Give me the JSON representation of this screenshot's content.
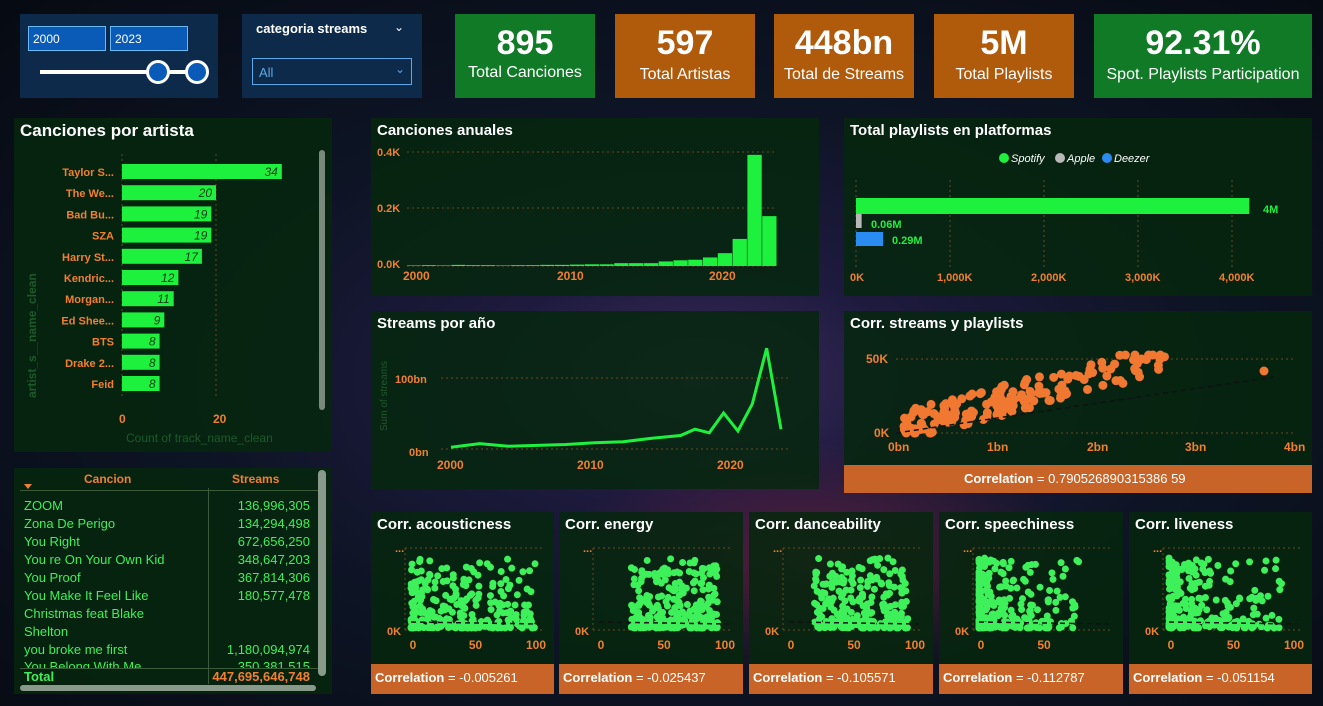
{
  "slicer": {
    "from": "2000",
    "to": "2023"
  },
  "category": {
    "title": "categoria streams",
    "value": "All"
  },
  "kpis": [
    {
      "value": "895",
      "label": "Total Canciones",
      "color": "#107a27"
    },
    {
      "value": "597",
      "label": "Total Artistas",
      "color": "#b05a0c"
    },
    {
      "value": "448bn",
      "label": "Total de Streams",
      "color": "#b05a0c"
    },
    {
      "value": "5M",
      "label": "Total Playlists",
      "color": "#b05a0c"
    },
    {
      "value": "92.31%",
      "label": "Spot. Playlists Participation",
      "color": "#107a27"
    }
  ],
  "artist_chart": {
    "title": "Canciones por artista",
    "ylabel": "artist_s__name_clean",
    "xlabel": "Count of track_name_clean",
    "xticks": [
      "0",
      "20"
    ]
  },
  "annual_chart": {
    "title": "Canciones anuales",
    "yticks": [
      "0.4K",
      "0.2K",
      "0.0K"
    ],
    "xticks": [
      "2000",
      "2010",
      "2020"
    ]
  },
  "streams_chart": {
    "title": "Streams por año",
    "ylabel": "Sum of streams",
    "yticks": [
      "100bn",
      "0bn"
    ],
    "xticks": [
      "2000",
      "2010",
      "2020"
    ]
  },
  "playlists_chart": {
    "title": "Total playlists en platformas",
    "legend": [
      "Spotify",
      "Apple",
      "Deezer"
    ],
    "xticks": [
      "0K",
      "1,000K",
      "2,000K",
      "3,000K",
      "4,000K"
    ],
    "labels": [
      "4M",
      "0.06M",
      "0.29M"
    ]
  },
  "scatter_main": {
    "title": "Corr. streams y playlists",
    "yticks": [
      "50K",
      "0K"
    ],
    "xticks": [
      "0bn",
      "1bn",
      "2bn",
      "3bn",
      "4bn"
    ],
    "corr_label": "Correlation",
    "corr_value": "= 0.790526890315386 59"
  },
  "small_corrs": [
    {
      "title": "Corr. acousticness",
      "corr": "= -0.005261",
      "xticks": [
        "0",
        "50",
        "100"
      ]
    },
    {
      "title": "Corr. energy",
      "corr": "= -0.025437",
      "xticks": [
        "0",
        "50",
        "100"
      ]
    },
    {
      "title": "Corr. danceability",
      "corr": "= -0.105571",
      "xticks": [
        "0",
        "50",
        "100"
      ]
    },
    {
      "title": "Corr. speechiness",
      "corr": "= -0.112787",
      "xticks": [
        "0",
        "50"
      ]
    },
    {
      "title": "Corr. liveness",
      "corr": "= -0.051154",
      "xticks": [
        "0",
        "50",
        "100"
      ]
    }
  ],
  "small_ytick": "0K",
  "small_ydots": "...",
  "corr_word": "Correlation",
  "table": {
    "headers": [
      "Cancion",
      "Streams"
    ],
    "rows": [
      {
        "c": "ZOOM",
        "s": "136,996,305"
      },
      {
        "c": "Zona De Perigo",
        "s": "134,294,498"
      },
      {
        "c": "You Right",
        "s": "672,656,250"
      },
      {
        "c": "You re On Your Own Kid",
        "s": "348,647,203"
      },
      {
        "c": "You Proof",
        "s": "367,814,306"
      },
      {
        "c": "You Make It Feel Like",
        "s": "180,577,478"
      },
      {
        "c": "Christmas feat Blake",
        "s": ""
      },
      {
        "c": "Shelton",
        "s": ""
      },
      {
        "c": "you broke me first",
        "s": "1,180,094,974"
      },
      {
        "c": "You Belong With Me",
        "s": "350,381,515"
      }
    ],
    "total_label": "Total",
    "total_value": "447,695,646,748"
  },
  "chart_data": [
    {
      "type": "bar",
      "title": "Canciones por artista",
      "xlabel": "Count of track_name_clean",
      "ylabel": "artist_s__name_clean",
      "categories": [
        "Taylor S...",
        "The We...",
        "Bad Bu...",
        "SZA",
        "Harry St...",
        "Kendric...",
        "Morgan...",
        "Ed Shee...",
        "BTS",
        "Drake 2...",
        "Feid"
      ],
      "values": [
        34,
        20,
        19,
        19,
        17,
        12,
        11,
        9,
        8,
        8,
        8
      ],
      "xlim": [
        0,
        40
      ],
      "color": "#1ef03e"
    },
    {
      "type": "bar",
      "title": "Canciones anuales",
      "x": [
        1999,
        2000,
        2001,
        2002,
        2003,
        2004,
        2005,
        2006,
        2007,
        2008,
        2009,
        2010,
        2011,
        2012,
        2013,
        2014,
        2015,
        2016,
        2017,
        2018,
        2019,
        2020,
        2021,
        2022,
        2023
      ],
      "values": [
        2,
        3,
        2,
        4,
        3,
        3,
        2,
        3,
        3,
        4,
        4,
        5,
        6,
        6,
        10,
        10,
        10,
        16,
        20,
        22,
        30,
        45,
        95,
        390,
        175
      ],
      "ylim": [
        0,
        400
      ],
      "color": "#1ef03e"
    },
    {
      "type": "line",
      "title": "Streams por año",
      "x": [
        2000,
        2002,
        2004,
        2006,
        2008,
        2010,
        2012,
        2014,
        2016,
        2017,
        2018,
        2019,
        2020,
        2021,
        2022,
        2023
      ],
      "values": [
        2,
        6,
        3,
        4,
        5,
        7,
        8,
        12,
        15,
        22,
        18,
        40,
        20,
        50,
        112,
        22
      ],
      "ylim": [
        0,
        120
      ],
      "color": "#1ef03e"
    },
    {
      "type": "bar",
      "title": "Total playlists en platformas",
      "orientation": "horizontal",
      "series": [
        {
          "name": "Spotify",
          "values": [
            4200000
          ]
        },
        {
          "name": "Apple",
          "values": [
            60000
          ]
        },
        {
          "name": "Deezer",
          "values": [
            290000
          ]
        }
      ],
      "xlim": [
        0,
        4400000
      ],
      "colors": [
        "#1ef03e",
        "#b8b8b8",
        "#2a8cf0"
      ]
    },
    {
      "type": "scatter",
      "title": "Corr. streams y playlists",
      "xlim": [
        0,
        4
      ],
      "ylim": [
        0,
        60000
      ],
      "color": "#f07830",
      "trend": true
    }
  ]
}
